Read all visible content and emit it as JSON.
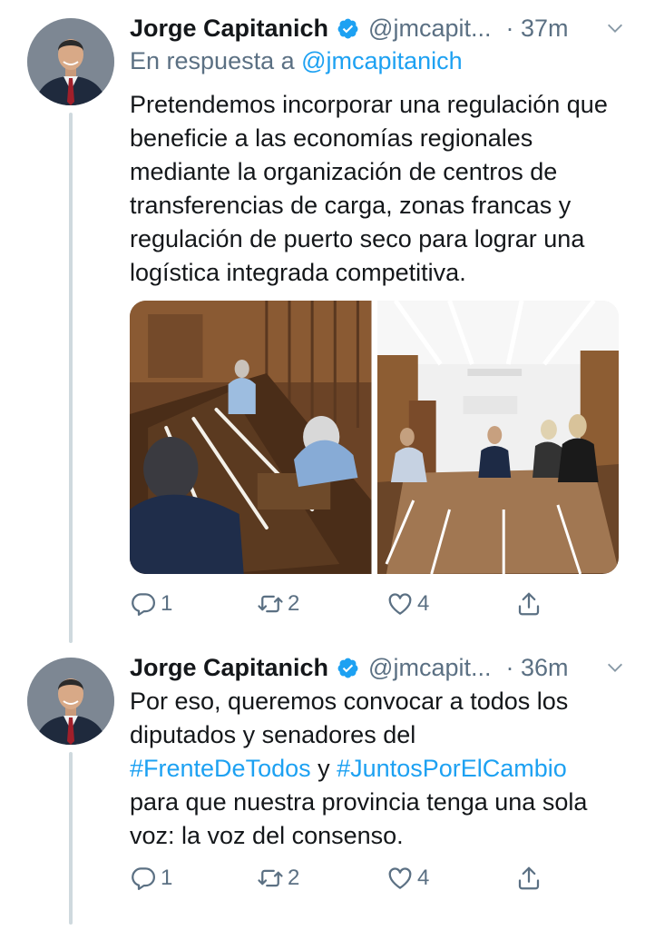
{
  "tweets": [
    {
      "author_name": "Jorge Capitanich",
      "handle": "@jmcapit...",
      "time": "· 37m",
      "reply_prefix": "En respuesta a",
      "reply_to": "@jmcapitanich",
      "text": "Pretendemos incorporar una regulación que beneficie a las economías regionales mediante la organización de centros de transferencias de carga, zonas francas y regulación de puerto seco para lograr una logística integrada competitiva.",
      "replies": "1",
      "retweets": "2",
      "likes": "4"
    },
    {
      "author_name": "Jorge Capitanich",
      "handle": "@jmcapit...",
      "time": "· 36m",
      "text_1": "Por eso, queremos convocar a todos los diputados y senadores del",
      "hashtag_1": "#FrenteDeTodos",
      "text_2": " y ",
      "hashtag_2": "#JuntosPorElCambio",
      "text_3": "para que nuestra provincia tenga una sola voz: la voz del consenso.",
      "replies": "1",
      "retweets": "2",
      "likes": "4"
    }
  ],
  "icons": [
    "verified-badge-icon",
    "chevron-down-icon",
    "reply-icon",
    "retweet-icon",
    "like-icon",
    "share-icon"
  ],
  "colors": {
    "link": "#1da1f2",
    "secondary_text": "#5b7083",
    "thread_line": "#cfd9de"
  }
}
